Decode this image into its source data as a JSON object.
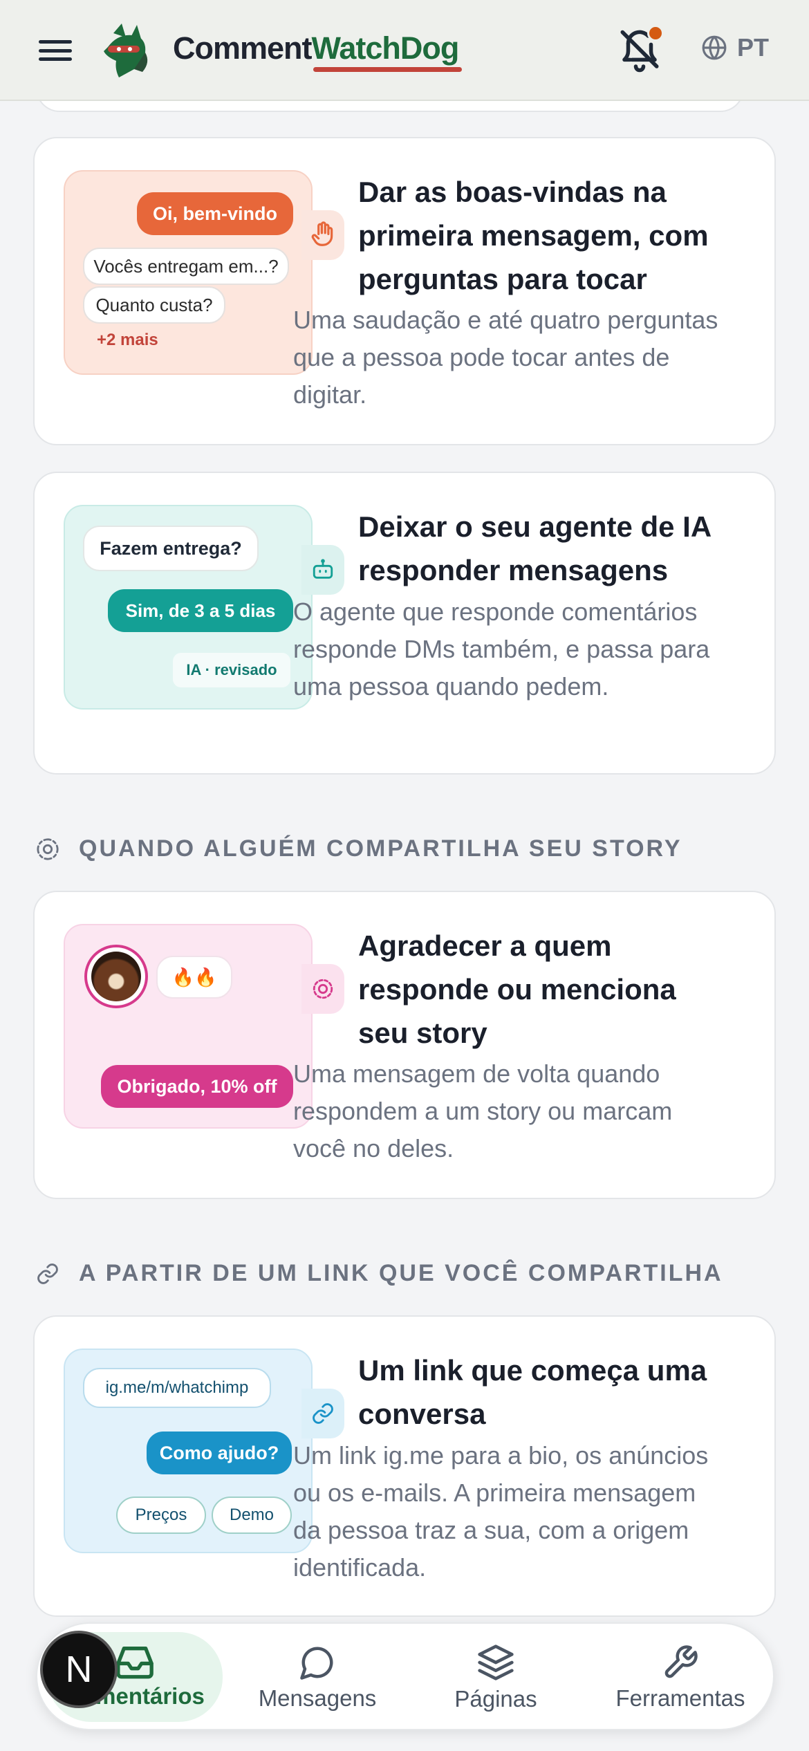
{
  "header": {
    "brand_part1": "Comment",
    "brand_part2": "WatchDog",
    "language": "PT"
  },
  "cards": [
    {
      "title": "Dar as boas-vindas na primeira mensagem, com perguntas para tocar",
      "description": "Uma saudação e até quatro perguntas que a pessoa pode tocar antes de digitar.",
      "illustration": {
        "greeting": "Oi, bem-vindo",
        "question_1": "Vocês entregam em...?",
        "question_2": "Quanto custa?",
        "more": "+2 mais"
      }
    },
    {
      "title": "Deixar o seu agente de IA responder mensagens",
      "description": "O agente que responde comentários responde DMs também, e passa para uma pessoa quando pedem.",
      "illustration": {
        "question": "Fazem entrega?",
        "answer": "Sim, de 3 a 5 dias",
        "tag": "IA · revisado"
      }
    },
    {
      "title": "Agradecer a quem responde ou menciona seu story",
      "description": "Uma mensagem de volta quando respondem a um story ou marcam você no deles.",
      "illustration": {
        "reaction": "🔥🔥",
        "reply": "Obrigado, 10% off"
      }
    },
    {
      "title": "Um link que começa uma conversa",
      "description": "Um link ig.me para a bio, os anúncios ou os e-mails. A primeira mensagem da pessoa traz a sua, com a origem identificada.",
      "illustration": {
        "link": "ig.me/m/whatchimp",
        "reply": "Como ajudo?",
        "option_1": "Preços",
        "option_2": "Demo"
      }
    }
  ],
  "sections": {
    "story": "QUANDO ALGUÉM COMPARTILHA SEU STORY",
    "link": "A PARTIR DE UM LINK QUE VOCÊ COMPARTILHA"
  },
  "bottom_nav": {
    "items": [
      {
        "label": "Comentários",
        "icon": "inbox-icon",
        "active": true
      },
      {
        "label": "Mensagens",
        "icon": "chat-bubble-icon",
        "active": false
      },
      {
        "label": "Páginas",
        "icon": "layers-icon",
        "active": false
      },
      {
        "label": "Ferramentas",
        "icon": "wrench-icon",
        "active": false
      }
    ],
    "floating_badge": "N"
  },
  "colors": {
    "brand_green": "#1e6b3c",
    "brand_red": "#c2443a",
    "notification_dot": "#d45a12",
    "orange_bubble": "#e7673a",
    "teal_bubble": "#14a095",
    "pink_bubble": "#d63a8c",
    "blue_bubble": "#1a93c8"
  }
}
